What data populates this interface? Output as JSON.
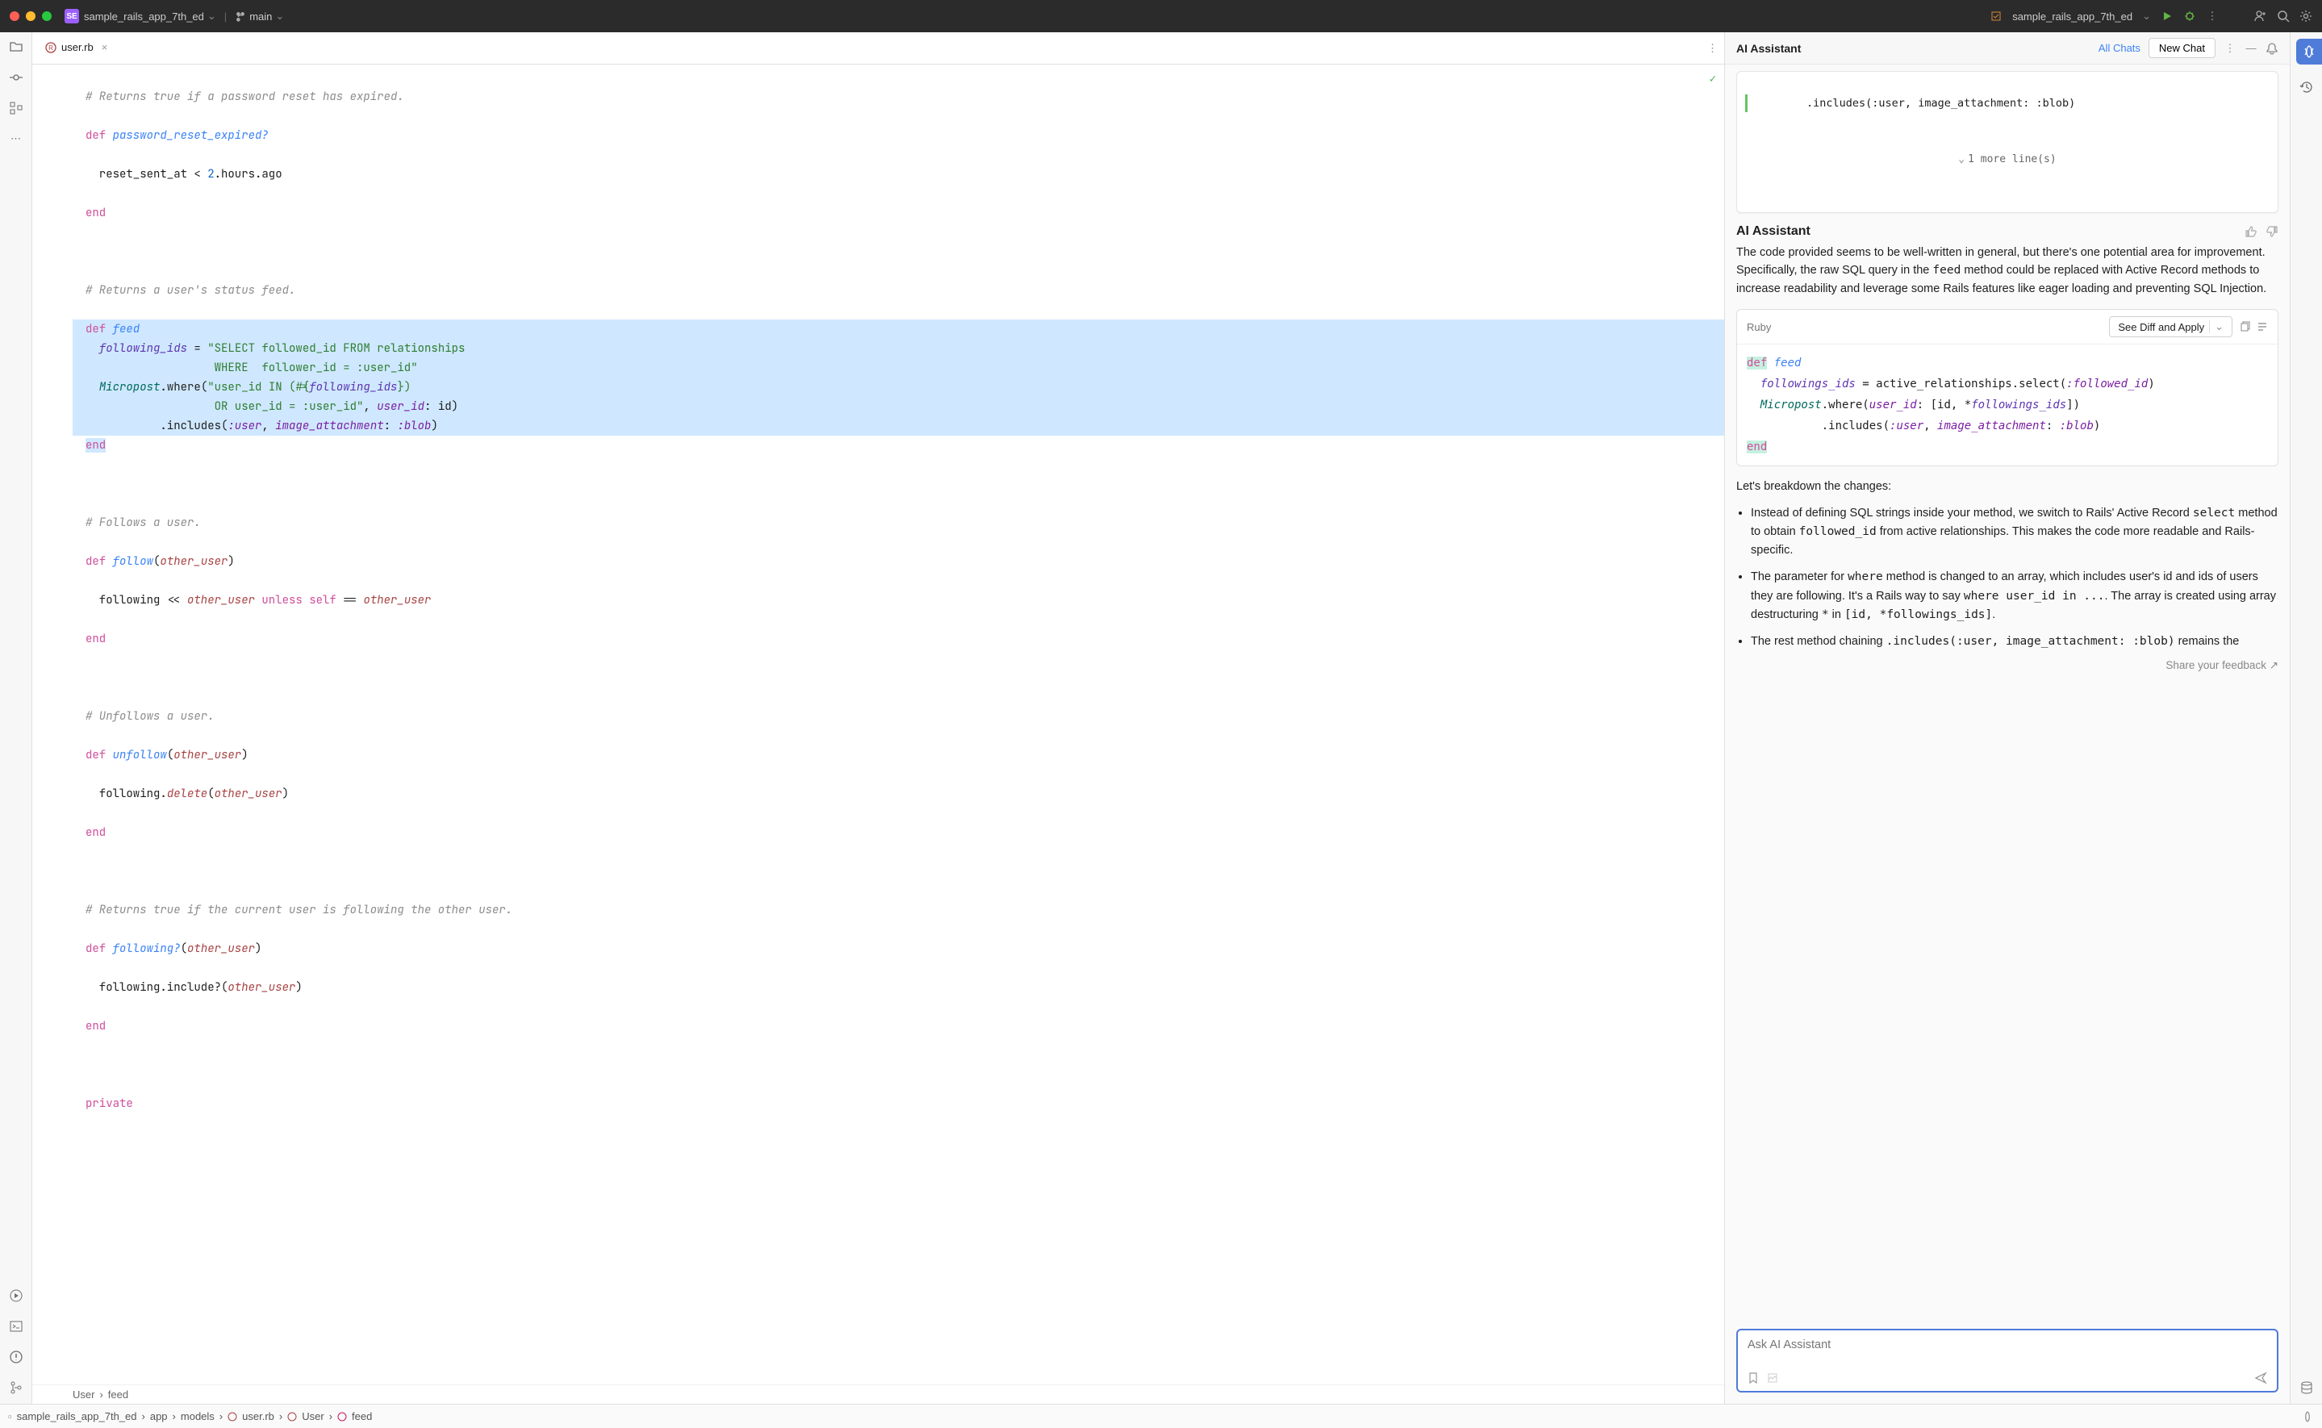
{
  "titlebar": {
    "project_badge": "SE",
    "project_name": "sample_rails_app_7th_ed",
    "branch": "main",
    "right_project": "sample_rails_app_7th_ed"
  },
  "tab": {
    "filename": "user.rb"
  },
  "breadcrumb": {
    "item1": "User",
    "item2": "feed"
  },
  "statusbar": {
    "project": "sample_rails_app_7th_ed",
    "app": "app",
    "models": "models",
    "file": "user.rb",
    "class": "User",
    "method": "feed"
  },
  "assistant": {
    "header_title": "AI Assistant",
    "all_chats": "All Chats",
    "new_chat": "New Chat",
    "prior_code_line": "        .includes(:user, image_attachment: :blob)",
    "expand_label": "1 more line(s)",
    "msg_title": "AI Assistant",
    "msg_body_pre": "The code provided seems to be well-written in general, but there's one potential area for improvement. Specifically, the raw SQL query in the ",
    "msg_body_code": "feed",
    "msg_body_post": " method could be replaced with Active Record methods to increase readability and leverage some Rails features like eager loading and preventing SQL Injection.",
    "codeblock_lang": "Ruby",
    "diff_button": "See Diff and Apply",
    "breakdown_intro": "Let's breakdown the changes:",
    "bullet1_a": "Instead of defining SQL strings inside your method, we switch to Rails' Active Record ",
    "bullet1_code1": "select",
    "bullet1_b": " method to obtain ",
    "bullet1_code2": "followed_id",
    "bullet1_c": " from active relationships. This makes the code more readable and Rails-specific.",
    "bullet2_a": "The parameter for ",
    "bullet2_code1": "where",
    "bullet2_b": " method is changed to an array, which includes user's id and ids of users they are following. It's a Rails way to say ",
    "bullet2_code2": "where user_id in ...",
    "bullet2_c": ". The array is created using array destructuring ",
    "bullet2_code3": "*",
    "bullet2_d": " in ",
    "bullet2_code4": "[id, *followings_ids]",
    "bullet2_e": ".",
    "bullet3_a": "The rest method chaining ",
    "bullet3_code1": ".includes(:user, image_attachment: :blob)",
    "bullet3_b": " remains the",
    "feedback": "Share your feedback ↗",
    "input_placeholder": "Ask AI Assistant"
  },
  "chart_data": null
}
